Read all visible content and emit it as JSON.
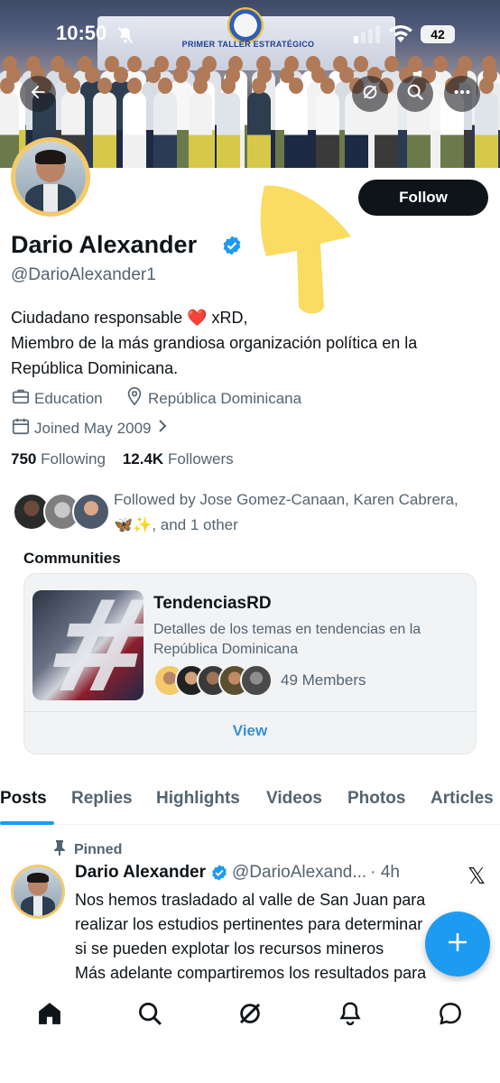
{
  "status_bar": {
    "time": "10:50",
    "battery": "42"
  },
  "banner": {
    "text": "PRIMER TALLER ESTRATÉGICO"
  },
  "profile": {
    "name": "Dario Alexander",
    "handle": "@DarioAlexander1",
    "follow_label": "Follow",
    "bio": [
      "Ciudadano responsable ❤️ xRD,",
      "Miembro de la más grandiosa organización política en la",
      "República Dominicana."
    ],
    "category": "Education",
    "location": "República Dominicana",
    "joined": "Joined May 2009",
    "following_count": "750",
    "following_label": "Following",
    "followers_count": "12.4K",
    "followers_label": "Followers",
    "followed_by": "Followed by Jose Gomez-Canaan, Karen Cabrera,",
    "followed_by_more": "🦋✨, and 1 other"
  },
  "communities": {
    "title": "Communities",
    "items": [
      {
        "name": "TendenciasRD",
        "description": "Detalles de los temas en tendencias en la República Dominicana",
        "members": "49 Members",
        "view_label": "View"
      }
    ]
  },
  "tabs": [
    "Posts",
    "Replies",
    "Highlights",
    "Videos",
    "Photos",
    "Articles"
  ],
  "pinned_post": {
    "pinned_label": "Pinned",
    "author": "Dario Alexander",
    "handle": "@DarioAlexand...",
    "time": "· 4h",
    "lines": [
      "Nos hemos trasladado al valle de San Juan para",
      "realizar los estudios pertinentes para determinar",
      "si se pueden explotar los recursos mineros",
      "Más adelante compartiremos los resultados para"
    ]
  },
  "icons": {
    "back": "back-arrow-icon",
    "grok": "grok-icon",
    "search": "search-icon",
    "more": "more-icon",
    "verified": "verified-badge-icon",
    "briefcase": "briefcase-icon",
    "location": "location-pin-icon",
    "calendar": "calendar-icon",
    "pin": "pin-icon",
    "x": "x-logo-icon",
    "compose": "plus-icon",
    "home": "home-icon",
    "notifications": "bell-icon",
    "messages": "messages-icon"
  },
  "colors": {
    "accent": "#1d9bf0",
    "text": "#0f1419",
    "secondary": "#536471",
    "link": "#3a8fd5"
  }
}
